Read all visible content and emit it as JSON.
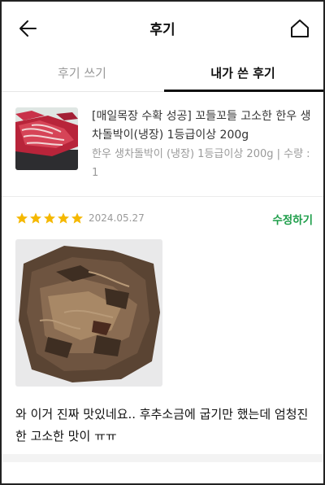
{
  "header": {
    "title": "후기",
    "back_icon": "arrow-left-icon",
    "home_icon": "home-icon"
  },
  "tabs": [
    {
      "label": "후기 쓰기",
      "active": false
    },
    {
      "label": "내가 쓴 후기",
      "active": true
    }
  ],
  "product": {
    "name": "[매일목장 수확 성공] 꼬들꼬들 고소한 한우 생차돌박이(냉장) 1등급이상 200g",
    "option": "한우 생차돌박이 (냉장) 1등급이상 200g | 수량 : 1"
  },
  "review": {
    "rating": 5,
    "date": "2024.05.27",
    "edit_label": "수정하기",
    "text": "와 이거 진짜 맛있네요.. 후추소금에 굽기만 했는데 엄청진한 고소한 맛이 ㅠㅠ"
  },
  "colors": {
    "star": "#f5b800",
    "edit": "#1e9e4a",
    "tab_active": "#111111",
    "tab_inactive": "#9a9a9a"
  }
}
